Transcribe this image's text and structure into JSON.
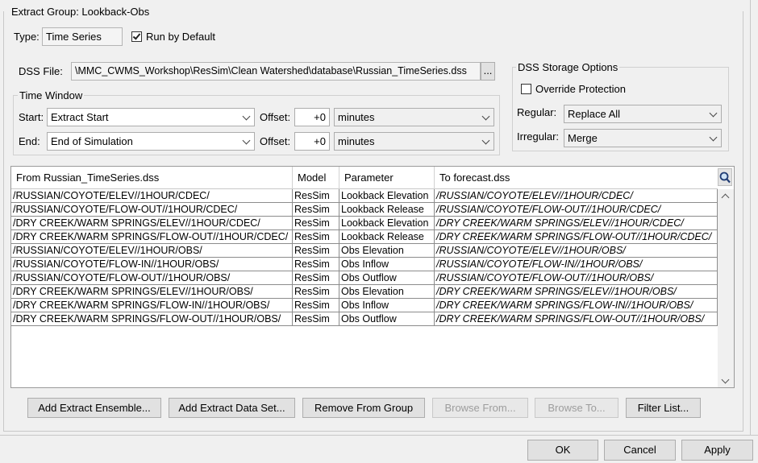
{
  "group": {
    "title": "Extract Group: Lookback-Obs"
  },
  "type": {
    "label": "Type:",
    "value": "Time Series"
  },
  "run_by_default": {
    "label": "Run by Default",
    "checked": true
  },
  "dss_file": {
    "label": "DSS File:",
    "value": "\\MMC_CWMS_Workshop\\ResSim\\Clean Watershed\\database\\Russian_TimeSeries.dss",
    "browse_label": "..."
  },
  "time_window": {
    "title": "Time Window",
    "start": {
      "label": "Start:",
      "value": "Extract Start",
      "offset_label": "Offset:",
      "offset_value": "+0",
      "unit": "minutes"
    },
    "end": {
      "label": "End:",
      "value": "End of Simulation",
      "offset_label": "Offset:",
      "offset_value": "+0",
      "unit": "minutes"
    }
  },
  "storage": {
    "title": "DSS Storage Options",
    "override": {
      "label": "Override Protection",
      "checked": false
    },
    "regular": {
      "label": "Regular:",
      "value": "Replace All"
    },
    "irregular": {
      "label": "Irregular:",
      "value": "Merge"
    }
  },
  "table": {
    "columns": [
      "From Russian_TimeSeries.dss",
      "Model",
      "Parameter",
      "To forecast.dss"
    ],
    "rows": [
      [
        "/RUSSIAN/COYOTE/ELEV//1HOUR/CDEC/",
        "ResSim",
        "Lookback Elevation",
        "/RUSSIAN/COYOTE/ELEV//1HOUR/CDEC/"
      ],
      [
        "/RUSSIAN/COYOTE/FLOW-OUT//1HOUR/CDEC/",
        "ResSim",
        "Lookback Release",
        "/RUSSIAN/COYOTE/FLOW-OUT//1HOUR/CDEC/"
      ],
      [
        "/DRY CREEK/WARM SPRINGS/ELEV//1HOUR/CDEC/",
        "ResSim",
        "Lookback Elevation",
        "/DRY CREEK/WARM SPRINGS/ELEV//1HOUR/CDEC/"
      ],
      [
        "/DRY CREEK/WARM SPRINGS/FLOW-OUT//1HOUR/CDEC/",
        "ResSim",
        "Lookback Release",
        "/DRY CREEK/WARM SPRINGS/FLOW-OUT//1HOUR/CDEC/"
      ],
      [
        "/RUSSIAN/COYOTE/ELEV//1HOUR/OBS/",
        "ResSim",
        "Obs Elevation",
        "/RUSSIAN/COYOTE/ELEV//1HOUR/OBS/"
      ],
      [
        "/RUSSIAN/COYOTE/FLOW-IN//1HOUR/OBS/",
        "ResSim",
        "Obs Inflow",
        "/RUSSIAN/COYOTE/FLOW-IN//1HOUR/OBS/"
      ],
      [
        "/RUSSIAN/COYOTE/FLOW-OUT//1HOUR/OBS/",
        "ResSim",
        "Obs Outflow",
        "/RUSSIAN/COYOTE/FLOW-OUT//1HOUR/OBS/"
      ],
      [
        "/DRY CREEK/WARM SPRINGS/ELEV//1HOUR/OBS/",
        "ResSim",
        "Obs Elevation",
        "/DRY CREEK/WARM SPRINGS/ELEV//1HOUR/OBS/"
      ],
      [
        "/DRY CREEK/WARM SPRINGS/FLOW-IN//1HOUR/OBS/",
        "ResSim",
        "Obs Inflow",
        "/DRY CREEK/WARM SPRINGS/FLOW-IN//1HOUR/OBS/"
      ],
      [
        "/DRY CREEK/WARM SPRINGS/FLOW-OUT//1HOUR/OBS/",
        "ResSim",
        "Obs Outflow",
        "/DRY CREEK/WARM SPRINGS/FLOW-OUT//1HOUR/OBS/"
      ]
    ]
  },
  "actions": {
    "add_ensemble": "Add Extract Ensemble...",
    "add_dataset": "Add Extract Data Set...",
    "remove": "Remove From Group",
    "browse_from": "Browse From...",
    "browse_to": "Browse To...",
    "filter": "Filter List..."
  },
  "dialog": {
    "ok": "OK",
    "cancel": "Cancel",
    "apply": "Apply"
  },
  "icons": {
    "search": "magnifier-icon"
  }
}
